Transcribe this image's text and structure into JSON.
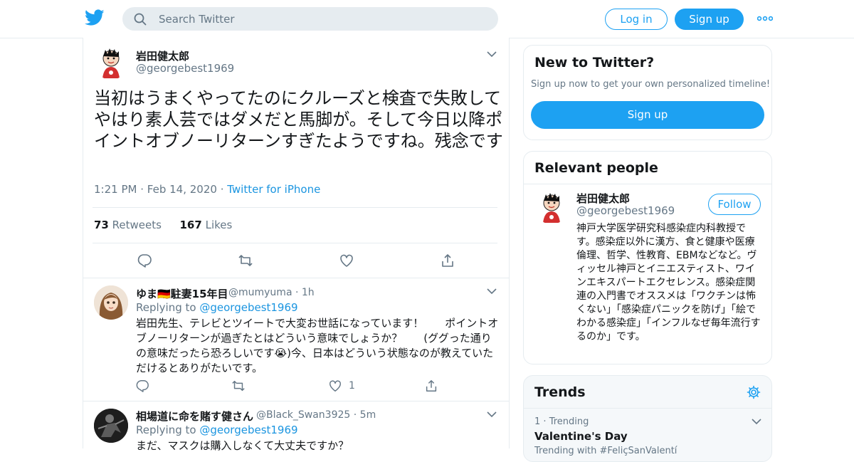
{
  "header": {
    "search_placeholder": "Search Twitter",
    "login_label": "Log in",
    "signup_label": "Sign up"
  },
  "tweet": {
    "author_name": "岩田健太郎",
    "author_handle": "@georgebest1969",
    "text": "当初はうまくやってたのにクルーズと検査で失敗してやはり素人芸ではダメだと馬脚が。そして今日以降ポイントオブノーリターンすぎたようですね。残念です",
    "time": "1:21 PM",
    "date": "Feb 14, 2020",
    "source": "Twitter for iPhone",
    "retweets_count": "73",
    "retweets_label": "Retweets",
    "likes_count": "167",
    "likes_label": "Likes"
  },
  "replies": [
    {
      "name": "ゆま🇩🇪駐妻15年目",
      "handle": "@mumyuma",
      "time": "1h",
      "replying_prefix": "Replying to",
      "replying_to": "@georgebest1969",
      "text": "岩田先生、テレビとツイートで大変お世話になっています！　　ポイントオブノーリターンが過ぎたとはどういう意味でしょうか？　　(ググった通りの意味だったら恐ろしいです😭)今、日本はどういう状態なのが教えていただけるとありがたいです。",
      "like_count": "1"
    },
    {
      "name": "相場道に命を賭す健さん",
      "handle": "@Black_Swan3925",
      "time": "5m",
      "replying_prefix": "Replying to",
      "replying_to": "@georgebest1969",
      "text": "まだ、マスクは購入しなくて大丈夫ですか？"
    }
  ],
  "sidebar": {
    "new_title": "New to Twitter?",
    "new_sub": "Sign up now to get your own personalized timeline!",
    "new_signup_label": "Sign up",
    "relevant_title": "Relevant people",
    "person_name": "岩田健太郎",
    "person_handle": "@georgebest1969",
    "follow_label": "Follow",
    "person_bio": "神戸大学医学研究科感染症内科教授です。感染症以外に漢方、食と健康や医療倫理、哲学、性教育、EBMなどなど。ヴィッセル神戸とイニエスティスト、ワインエキスパートエクセレンス。感染症関連の入門書でオススメは「ワクチンは怖くない」「感染症パニックを防げ」「絵でわかる感染症」「インフルなぜ毎年流行するのか」です。",
    "trends_title": "Trends",
    "trend_rank": "1",
    "trend_label": "Trending",
    "trend_name": "Valentine's Day",
    "trend_sub": "Trending with #FeliçSanValentí"
  },
  "colors": {
    "accent": "#1da1f2",
    "link": "#1b95e0",
    "muted": "#657786",
    "border": "#e6ecf0"
  },
  "icons": [
    "twitter-logo-icon",
    "search-icon",
    "more-icon",
    "chevron-down-icon",
    "reply-icon",
    "retweet-icon",
    "like-icon",
    "share-icon",
    "settings-icon"
  ]
}
